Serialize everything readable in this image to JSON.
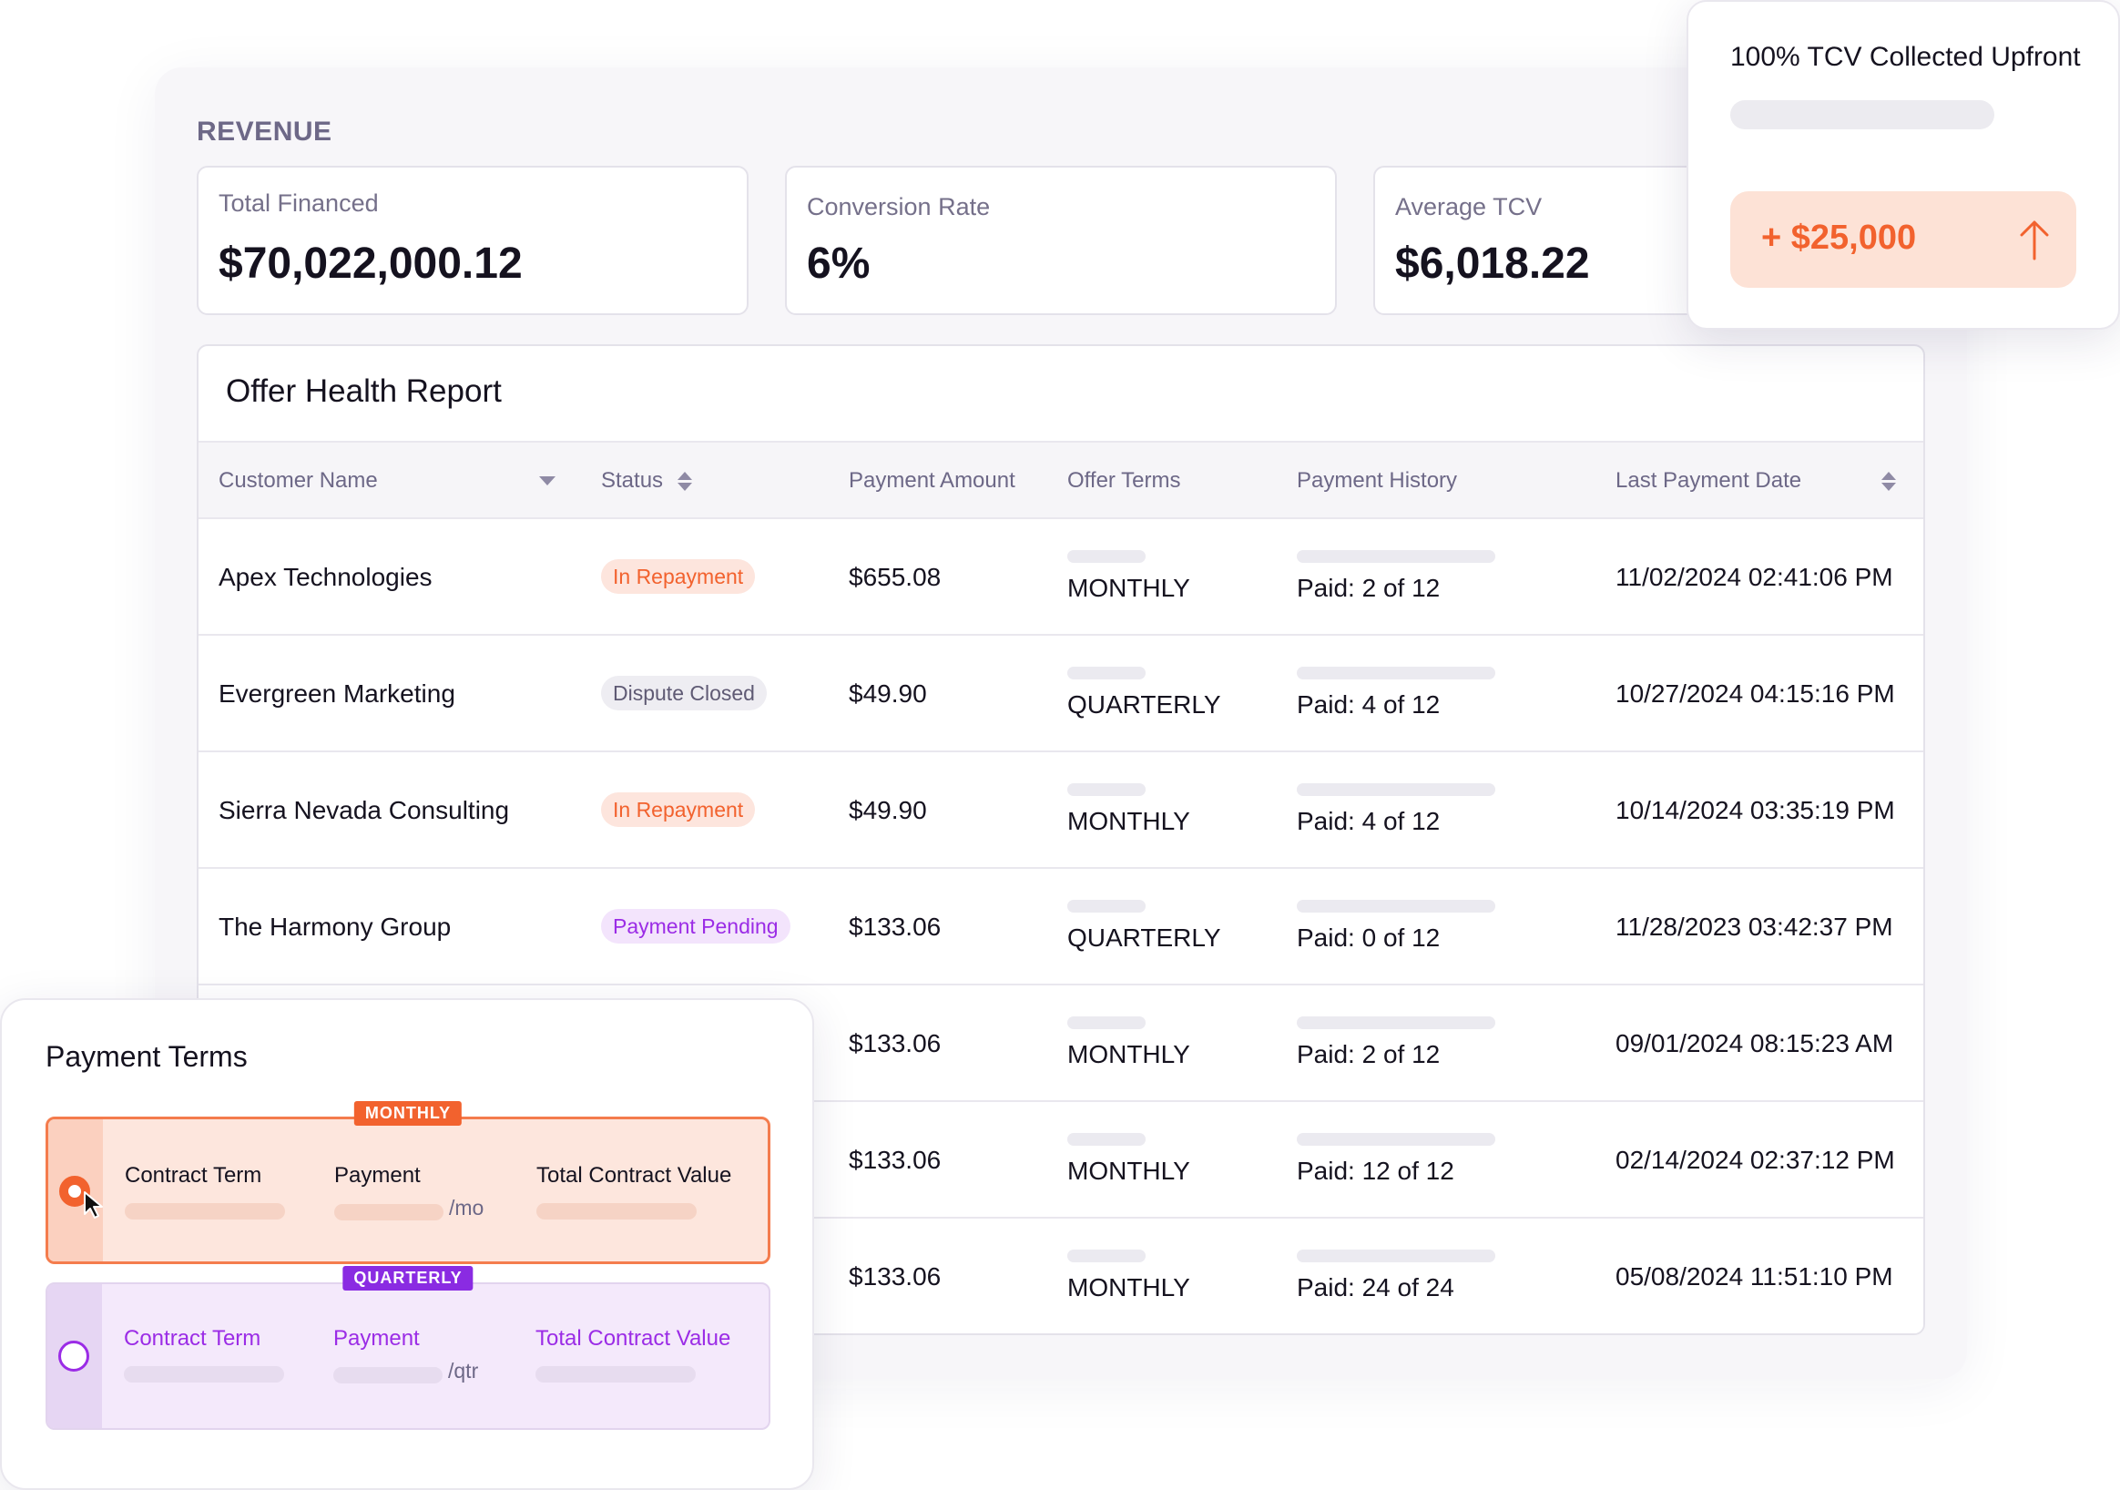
{
  "revenue": {
    "heading": "REVENUE",
    "metrics": [
      {
        "label": "Total Financed",
        "value": "$70,022,000.12"
      },
      {
        "label": "Conversion Rate",
        "value": "6%"
      },
      {
        "label": "Average TCV",
        "value": "$6,018.22"
      }
    ]
  },
  "report": {
    "title": "Offer Health Report",
    "columns": {
      "customer_name": "Customer Name",
      "status": "Status",
      "payment_amount": "Payment Amount",
      "offer_terms": "Offer Terms",
      "payment_history": "Payment History",
      "last_payment_date": "Last Payment Date"
    },
    "rows": [
      {
        "name": "Apex Technologies",
        "status": "In Repayment",
        "status_color": "orange",
        "amount": "$655.08",
        "terms": "MONTHLY",
        "history": "Paid: 2 of 12",
        "date": "11/02/2024 02:41:06 PM"
      },
      {
        "name": "Evergreen Marketing",
        "status": "Dispute Closed",
        "status_color": "gray",
        "amount": "$49.90",
        "terms": "QUARTERLY",
        "history": "Paid: 4 of 12",
        "date": "10/27/2024 04:15:16 PM"
      },
      {
        "name": "Sierra Nevada Consulting",
        "status": "In Repayment",
        "status_color": "orange",
        "amount": "$49.90",
        "terms": "MONTHLY",
        "history": "Paid: 4 of 12",
        "date": "10/14/2024 03:35:19 PM"
      },
      {
        "name": "The Harmony Group",
        "status": "Payment Pending",
        "status_color": "purple",
        "amount": "$133.06",
        "terms": "QUARTERLY",
        "history": "Paid: 0 of 12",
        "date": "11/28/2023 03:42:37 PM"
      },
      {
        "name": "",
        "status": "",
        "status_color": "none",
        "amount": "$133.06",
        "terms": "MONTHLY",
        "history": "Paid: 2 of 12",
        "date": "09/01/2024 08:15:23 AM"
      },
      {
        "name": "",
        "status": "",
        "status_color": "none",
        "amount": "$133.06",
        "terms": "MONTHLY",
        "history": "Paid: 12 of 12",
        "date": "02/14/2024 02:37:12 PM"
      },
      {
        "name": "",
        "status": "",
        "status_color": "none",
        "amount": "$133.06",
        "terms": "MONTHLY",
        "history": "Paid: 24 of 24",
        "date": "05/08/2024 11:51:10 PM"
      }
    ]
  },
  "tcv_popup": {
    "title": "100% TCV Collected Upfront",
    "amount": "+ $25,000",
    "icon": "arrow-up-icon"
  },
  "payment_terms": {
    "title": "Payment Terms",
    "plans": [
      {
        "tag": "MONTHLY",
        "contract_term_label": "Contract Term",
        "payment_label": "Payment",
        "unit": "/mo",
        "tcv_label": "Total Contract Value",
        "selected": true
      },
      {
        "tag": "QUARTERLY",
        "contract_term_label": "Contract Term",
        "payment_label": "Payment",
        "unit": "/qtr",
        "tcv_label": "Total Contract Value",
        "selected": false
      }
    ]
  },
  "colors": {
    "accent_orange": "#f2622e",
    "accent_purple": "#9b2ce6",
    "text_muted": "#6d6887"
  }
}
